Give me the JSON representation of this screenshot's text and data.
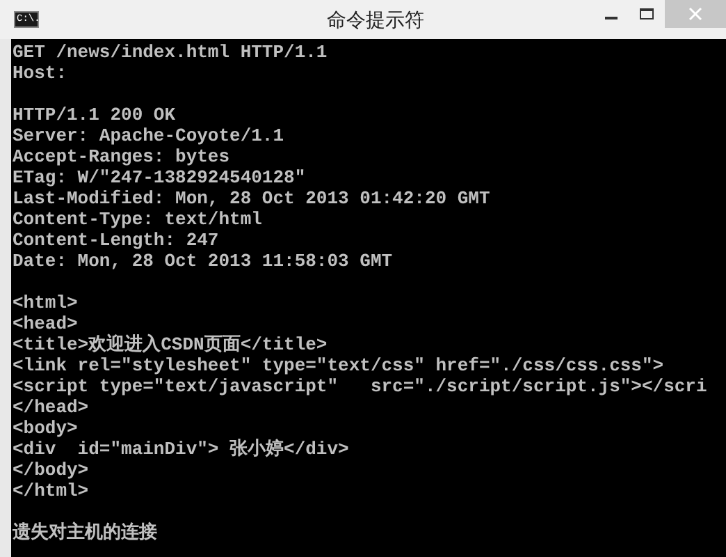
{
  "window": {
    "title": "命令提示符",
    "icon_text": "C:\\."
  },
  "lines": [
    {
      "kind": "text",
      "text": "GET /news/index.html HTTP/1.1"
    },
    {
      "kind": "text",
      "text": "Host:"
    },
    {
      "kind": "blank"
    },
    {
      "kind": "text",
      "text": "HTTP/1.1 200 OK"
    },
    {
      "kind": "text",
      "text": "Server: Apache-Coyote/1.1"
    },
    {
      "kind": "text",
      "text": "Accept-Ranges: bytes"
    },
    {
      "kind": "text",
      "text": "ETag: W/\"247-1382924540128\""
    },
    {
      "kind": "text",
      "text": "Last-Modified: Mon, 28 Oct 2013 01:42:20 GMT"
    },
    {
      "kind": "text",
      "text": "Content-Type: text/html"
    },
    {
      "kind": "text",
      "text": "Content-Length: 247"
    },
    {
      "kind": "text",
      "text": "Date: Mon, 28 Oct 2013 11:58:03 GMT"
    },
    {
      "kind": "blank"
    },
    {
      "kind": "text",
      "text": "<html>"
    },
    {
      "kind": "text",
      "text": "<head>"
    },
    {
      "kind": "text",
      "text": "<title>欢迎进入CSDN页面</title>"
    },
    {
      "kind": "text",
      "text": "<link rel=\"stylesheet\" type=\"text/css\" href=\"./css/css.css\">"
    },
    {
      "kind": "text",
      "text": "<script type=\"text/javascript\"   src=\"./script/script.js\"></scri"
    },
    {
      "kind": "text",
      "text": "</head>"
    },
    {
      "kind": "text",
      "text": "<body>"
    },
    {
      "kind": "text",
      "text": "<div  id=\"mainDiv\"> 张小婷</div>"
    },
    {
      "kind": "text",
      "text": "</body>"
    },
    {
      "kind": "text",
      "text": "</html>"
    },
    {
      "kind": "blank"
    },
    {
      "kind": "text",
      "text": "遗失对主机的连接"
    }
  ]
}
